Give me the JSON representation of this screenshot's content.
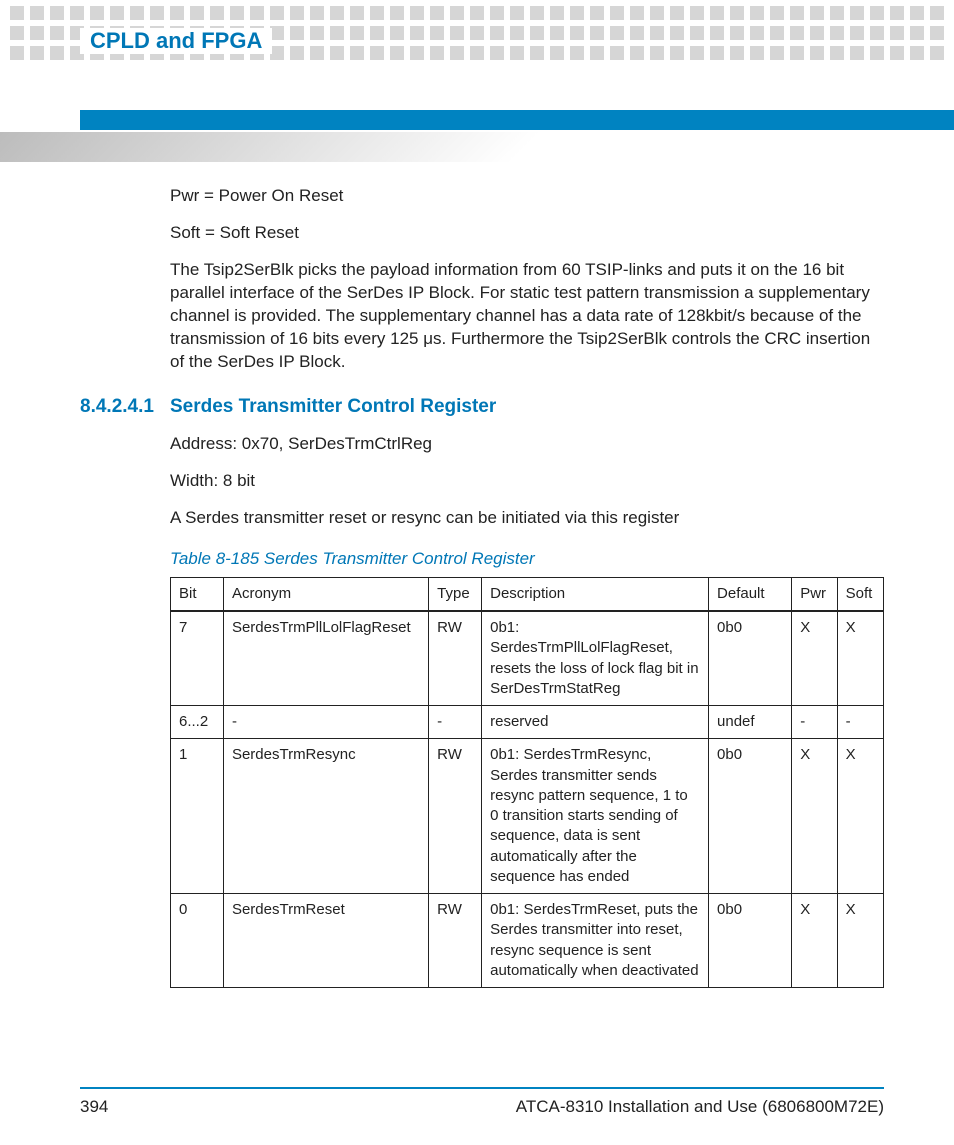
{
  "header": {
    "chapter_title": "CPLD and FPGA"
  },
  "body": {
    "p1": "Pwr = Power On Reset",
    "p2": "Soft = Soft Reset",
    "p3": "The Tsip2SerBlk picks the payload information from 60 TSIP-links and puts it on the 16 bit parallel interface of the SerDes IP Block. For static test pattern transmission a supplementary channel is provided. The supplementary channel has a data rate of 128kbit/s because of the transmission of 16 bits every 125 μs. Furthermore the Tsip2SerBlk controls the CRC insertion of the SerDes IP Block.",
    "section_num": "8.4.2.4.1",
    "section_title": "Serdes Transmitter Control Register",
    "p4": "Address: 0x70, SerDesTrmCtrlReg",
    "p5": "Width: 8 bit",
    "p6": "A Serdes transmitter reset or resync can be initiated via this register",
    "table_caption": "Table 8-185 Serdes Transmitter Control Register"
  },
  "table": {
    "headers": [
      "Bit",
      "Acronym",
      "Type",
      "Description",
      "Default",
      "Pwr",
      "Soft"
    ],
    "rows": [
      {
        "bit": "7",
        "acronym": "SerdesTrmPllLolFlagReset",
        "type": "RW",
        "description": "0b1: SerdesTrmPllLolFlagReset, resets the loss of lock flag bit in SerDesTrmStatReg",
        "default": "0b0",
        "pwr": "X",
        "soft": "X"
      },
      {
        "bit": "6...2",
        "acronym": "-",
        "type": "-",
        "description": "reserved",
        "default": "undef",
        "pwr": "-",
        "soft": "-"
      },
      {
        "bit": "1",
        "acronym": "SerdesTrmResync",
        "type": "RW",
        "description": "0b1: SerdesTrmResync, Serdes transmitter sends resync pattern sequence, 1 to 0 transition starts sending of sequence, data is sent automatically after the sequence has ended",
        "default": "0b0",
        "pwr": "X",
        "soft": "X"
      },
      {
        "bit": "0",
        "acronym": "SerdesTrmReset",
        "type": "RW",
        "description": "0b1: SerdesTrmReset, puts the Serdes transmitter into reset, resync sequence is sent automatically when deactivated",
        "default": "0b0",
        "pwr": "X",
        "soft": "X"
      }
    ]
  },
  "footer": {
    "page_number": "394",
    "doc_title": "ATCA-8310 Installation and Use (6806800M72E)"
  }
}
